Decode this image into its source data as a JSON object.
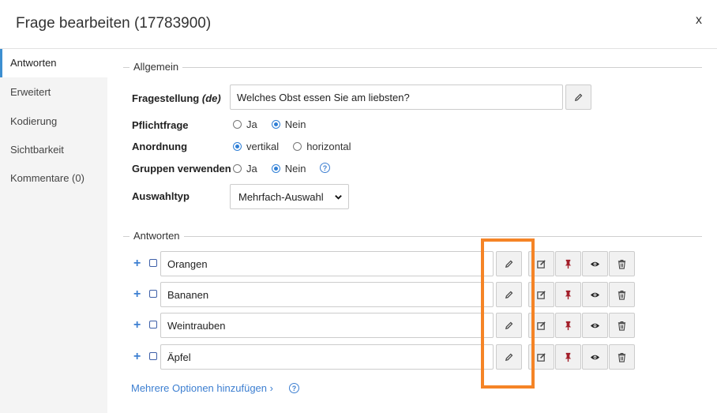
{
  "dialog": {
    "title": "Frage bearbeiten (17783900)",
    "close_label": "x"
  },
  "sidebar": {
    "items": [
      {
        "label": "Antworten"
      },
      {
        "label": "Erweitert"
      },
      {
        "label": "Kodierung"
      },
      {
        "label": "Sichtbarkeit"
      },
      {
        "label": "Kommentare (0)"
      }
    ]
  },
  "general": {
    "legend": "Allgemein",
    "question_label": "Fragestellung",
    "question_lang": "(de)",
    "question_value": "Welches Obst essen Sie am liebsten?",
    "mandatory": {
      "label": "Pflichtfrage",
      "options": [
        "Ja",
        "Nein"
      ],
      "selected": "Nein"
    },
    "arrangement": {
      "label": "Anordnung",
      "options": [
        "vertikal",
        "horizontal"
      ],
      "selected": "vertikal"
    },
    "groups": {
      "label": "Gruppen verwenden",
      "options": [
        "Ja",
        "Nein"
      ],
      "selected": "Nein",
      "help": "?"
    },
    "choice_type": {
      "label": "Auswahltyp",
      "value": "Mehrfach-Auswahl"
    }
  },
  "answers": {
    "legend": "Antworten",
    "items": [
      {
        "label": "Orangen"
      },
      {
        "label": "Bananen"
      },
      {
        "label": "Weintrauben"
      },
      {
        "label": "Äpfel"
      }
    ],
    "add_more_label": "Mehrere Optionen hinzufügen ›",
    "add_more_help": "?"
  },
  "colors": {
    "accent": "#3d7fd1",
    "highlight": "#f58426",
    "pin": "#a31f2a"
  }
}
